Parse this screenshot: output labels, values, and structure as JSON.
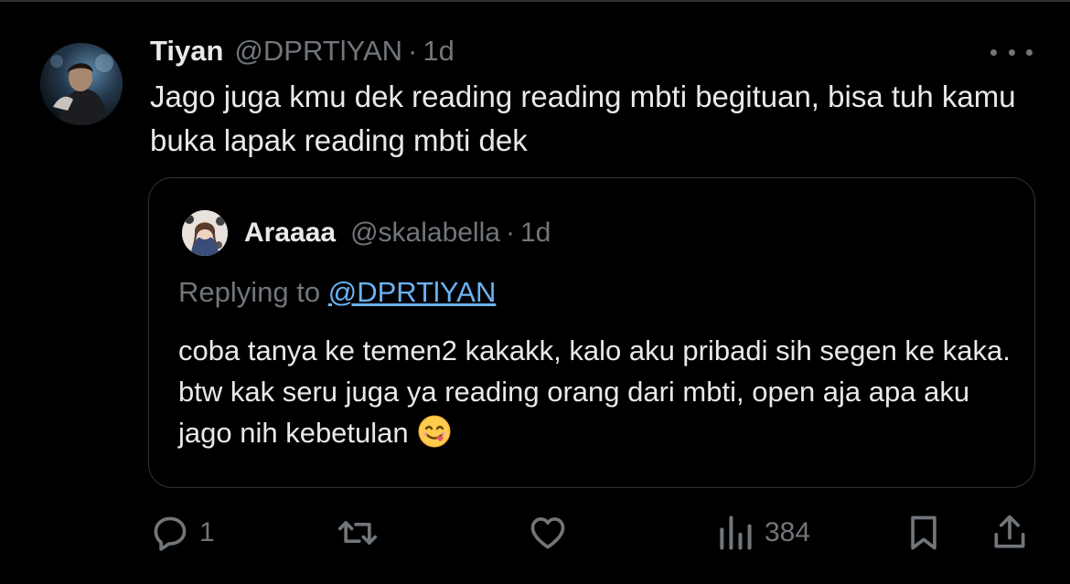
{
  "tweet": {
    "display_name": "Tiyan",
    "handle": "@DPRTlYAN",
    "separator": "·",
    "time": "1d",
    "text": "Jago juga kmu dek reading reading mbti begituan, bisa tuh kamu buka lapak reading mbti dek",
    "avatar_icon": "profile-photo"
  },
  "quote": {
    "display_name": "Araaaa",
    "handle": "@skalabella",
    "separator": "·",
    "time": "1d",
    "replying_prefix": "Replying to",
    "replying_handle": "@DPRTlYAN",
    "text": "coba tanya ke temen2 kakakk, kalo aku pribadi sih segen ke kaka. btw kak seru juga ya reading orang dari mbti, open aja apa aku jago nih kebetulan",
    "emoji": "face-savoring-food-emoji"
  },
  "actions": {
    "reply_count": "1",
    "retweet_count": "",
    "like_count": "",
    "views_count": "384"
  },
  "colors": {
    "background": "#000000",
    "text_primary": "#e7e9ea",
    "text_secondary": "#71767b",
    "link": "#6ab3f3",
    "border": "#2f3336"
  }
}
